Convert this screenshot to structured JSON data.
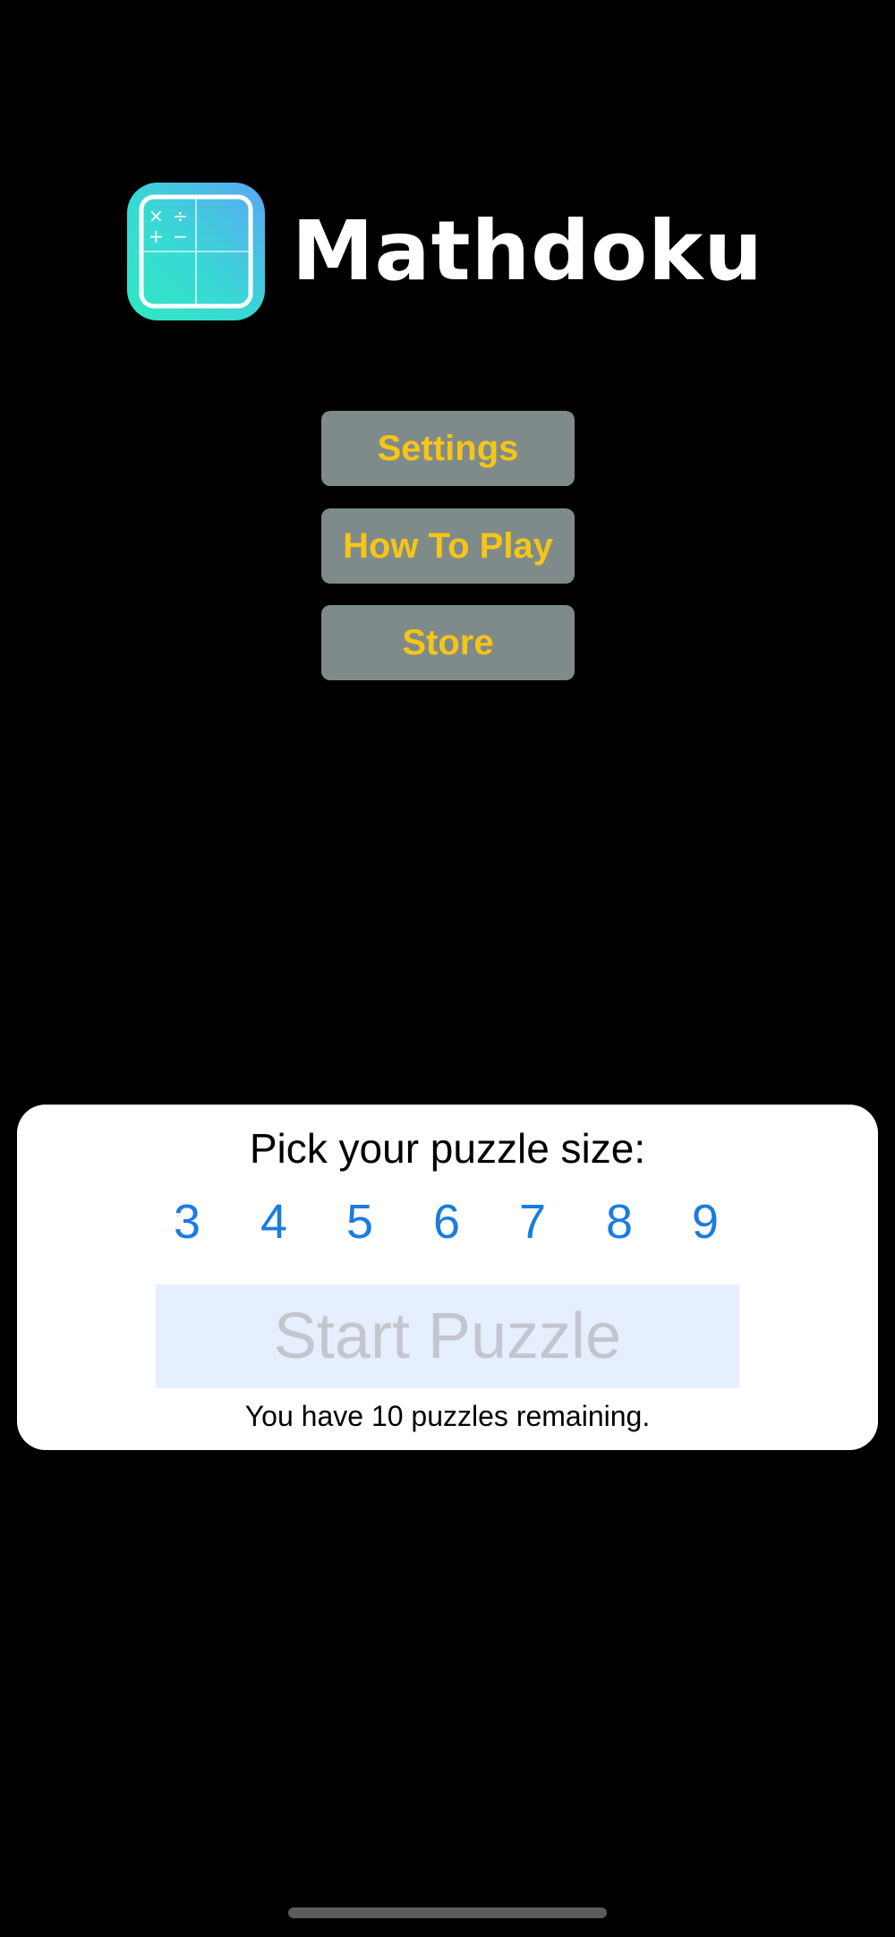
{
  "app": {
    "title": "Mathdoku",
    "icon": "mathdoku-grid-icon",
    "icon_symbols": [
      "×",
      "÷",
      "+",
      "−"
    ]
  },
  "menu": {
    "settings_label": "Settings",
    "how_to_play_label": "How To Play",
    "store_label": "Store"
  },
  "puzzle_picker": {
    "title": "Pick your puzzle size:",
    "sizes": [
      "3",
      "4",
      "5",
      "6",
      "7",
      "8",
      "9"
    ],
    "start_label": "Start Puzzle",
    "remaining_text": "You have 10 puzzles remaining."
  },
  "colors": {
    "background": "#000000",
    "button_bg": "#7f8a8a",
    "button_text": "#f5c518",
    "size_link": "#1a7ce0",
    "start_bg": "#e6efff",
    "start_text_disabled": "#c3c6cd"
  }
}
